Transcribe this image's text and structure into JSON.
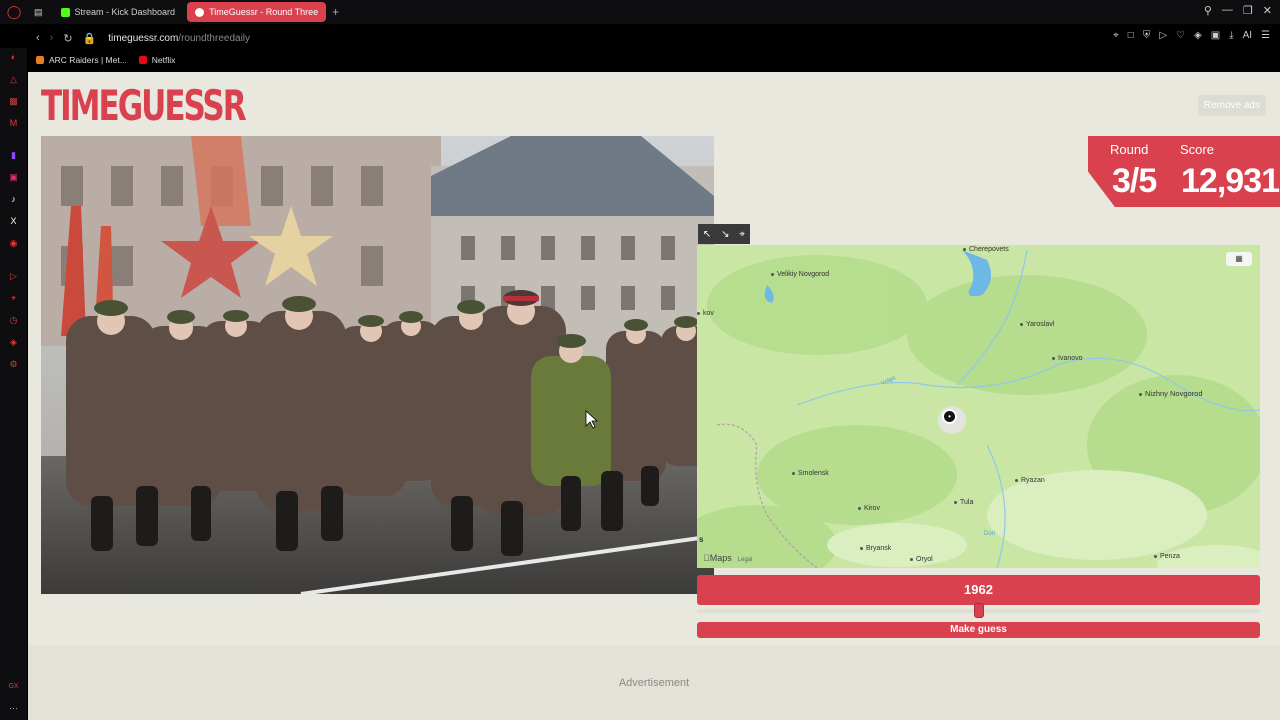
{
  "browser": {
    "tabs": [
      {
        "label": "Stream - Kick Dashboard",
        "active": false
      },
      {
        "label": "TimeGuessr - Round Three",
        "active": true
      }
    ],
    "url_host": "timeguessr.com",
    "url_path": "/roundthreedaily",
    "bookmarks": [
      {
        "label": "ARC Raiders | Met..."
      },
      {
        "label": "Netflix"
      }
    ],
    "ai_label": "AI"
  },
  "header": {
    "logo": "TIMEGUESSR",
    "remove_ads": "Remove ads"
  },
  "score": {
    "round_label": "Round",
    "round_value": "3/5",
    "score_label": "Score",
    "score_value": "12,931"
  },
  "map": {
    "attribution": "Maps",
    "legal": "Legal",
    "places": [
      {
        "name": "Cherepovets",
        "major": false
      },
      {
        "name": "Velikiy Novgorod",
        "major": false
      },
      {
        "name": "Yaroslavl",
        "major": false
      },
      {
        "name": "Ivanovo",
        "major": false
      },
      {
        "name": "Nizhny Novgorod",
        "major": true
      },
      {
        "name": "Smolensk",
        "major": false
      },
      {
        "name": "Ryazan",
        "major": false
      },
      {
        "name": "Tula",
        "major": false
      },
      {
        "name": "Kirov",
        "major": false
      },
      {
        "name": "Bryansk",
        "major": false
      },
      {
        "name": "Oryol",
        "major": false
      },
      {
        "name": "Penza",
        "major": false
      },
      {
        "name": "kov",
        "major": false
      }
    ],
    "river_volga": "Volga",
    "river_don": "Don",
    "edge_s": "s"
  },
  "guess": {
    "year": "1962",
    "slider_fraction": 0.5,
    "button_label": "Make guess"
  },
  "ad": {
    "label": "Advertisement"
  },
  "colors": {
    "accent": "#d9414e",
    "page_bg": "#e8e8df",
    "map_land": "#c9e6a4"
  }
}
